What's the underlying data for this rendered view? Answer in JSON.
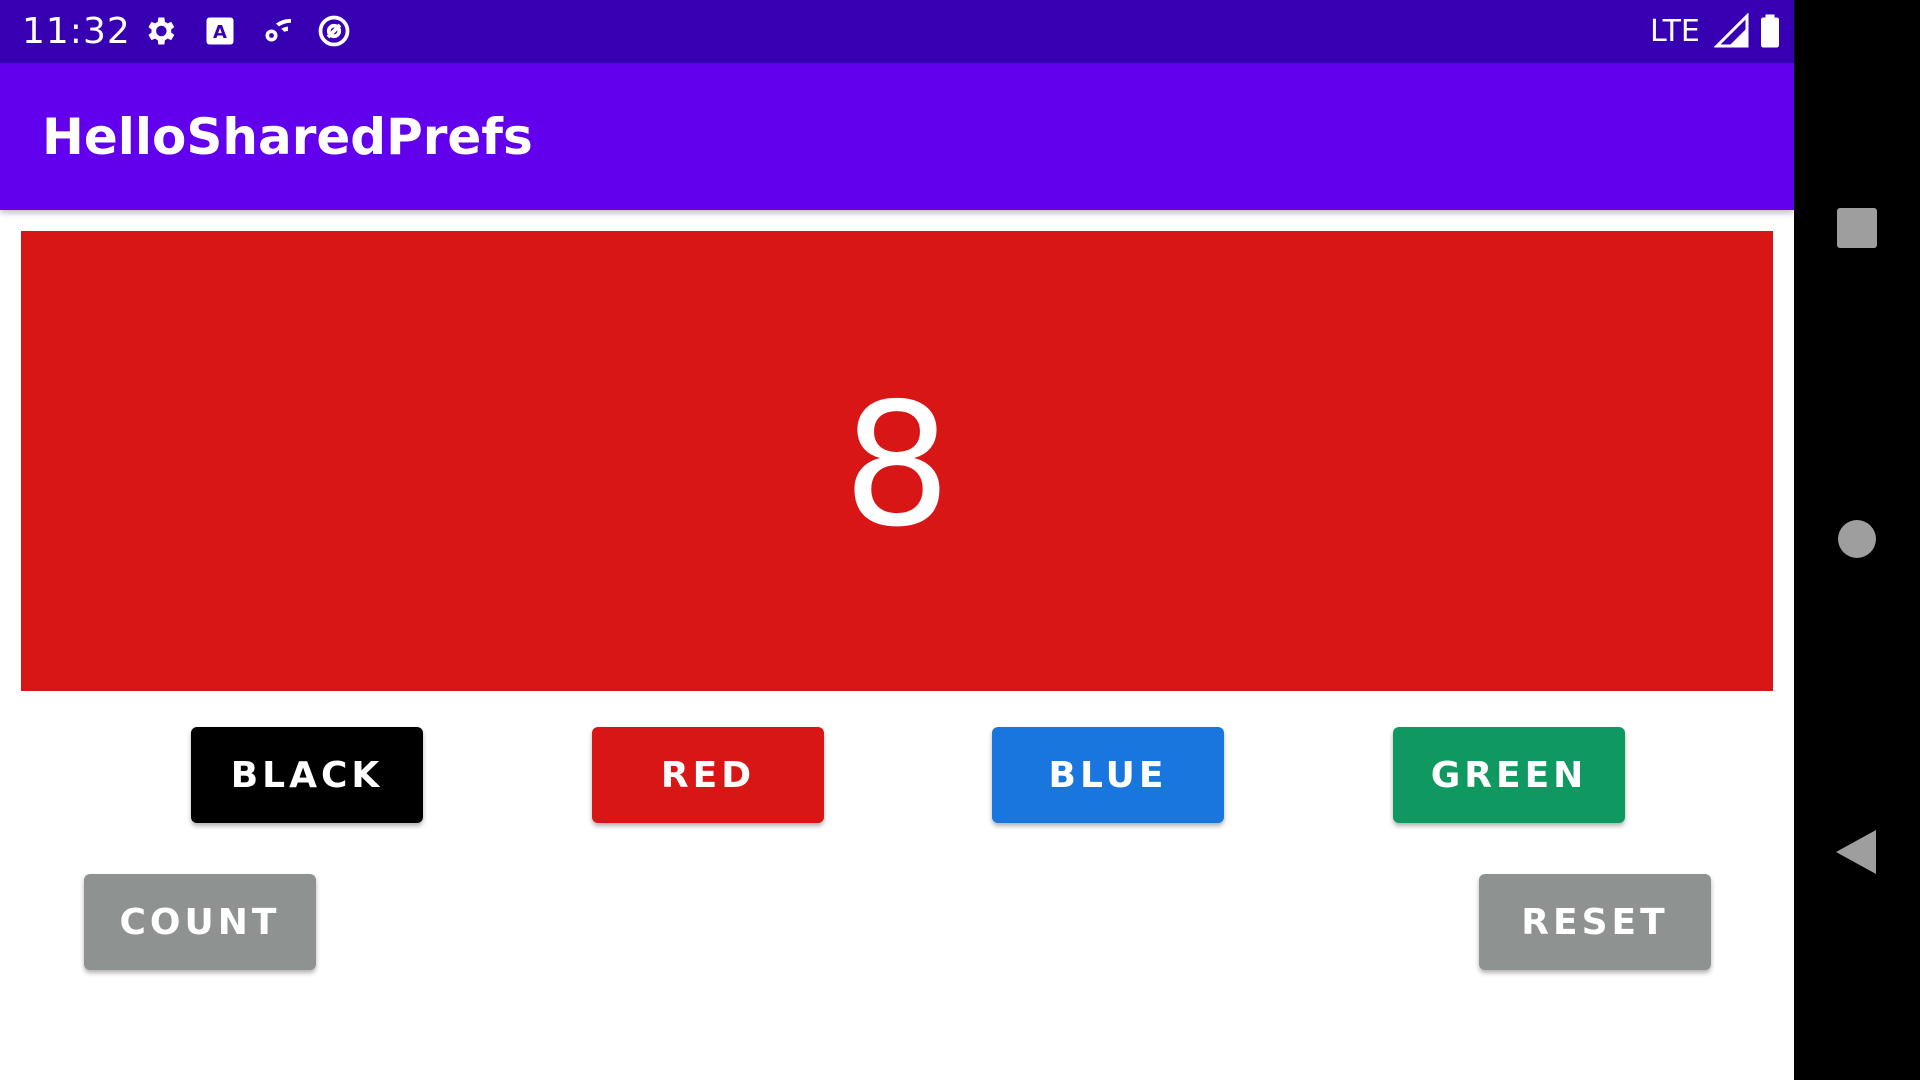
{
  "status_bar": {
    "time": "11:32",
    "network": "LTE",
    "icons": [
      "gear-icon",
      "text-a-icon",
      "wifi-gear-icon",
      "at-sign-icon",
      "signal-icon",
      "battery-icon"
    ]
  },
  "app_bar": {
    "title": "HelloSharedPrefs",
    "color": "#6200ee"
  },
  "counter": {
    "value": "8",
    "background": "#d91616"
  },
  "color_buttons": [
    {
      "label": "BLACK",
      "color": "#000000"
    },
    {
      "label": "RED",
      "color": "#d91616"
    },
    {
      "label": "BLUE",
      "color": "#1976de"
    },
    {
      "label": "GREEN",
      "color": "#0f9960"
    }
  ],
  "actions": {
    "count_label": "COUNT",
    "reset_label": "RESET",
    "button_color": "#8e9290"
  },
  "nav_bar": {
    "icons": [
      "recents-square-icon",
      "home-circle-icon",
      "back-triangle-icon"
    ]
  }
}
